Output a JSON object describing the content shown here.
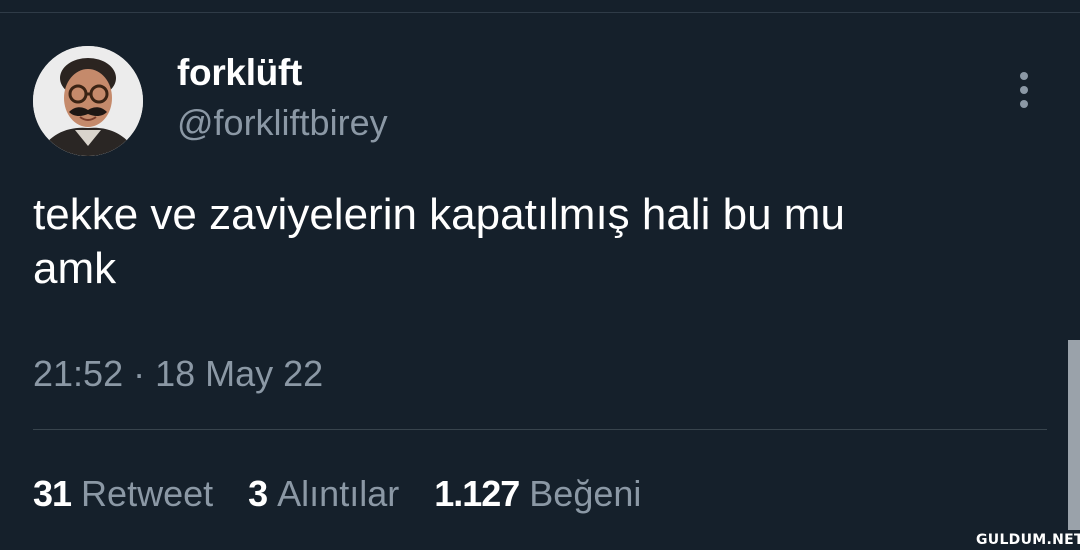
{
  "user": {
    "display_name": "forklüft",
    "handle": "@forkliftbirey"
  },
  "tweet": {
    "text": "tekke ve zaviyelerin kapatılmış hali bu mu\namk",
    "timestamp": "21:52 · 18 May 22"
  },
  "stats": [
    {
      "count": "31",
      "label": "Retweet"
    },
    {
      "count": "3",
      "label": "Alıntılar"
    },
    {
      "count": "1.127",
      "label": "Beğeni"
    }
  ],
  "icons": {
    "more": "more-vertical-icon"
  },
  "watermark": "GULDUM.NET",
  "colors": {
    "background": "#15202b",
    "text_primary": "#ffffff",
    "text_secondary": "#8b98a5",
    "divider": "#38444d"
  }
}
